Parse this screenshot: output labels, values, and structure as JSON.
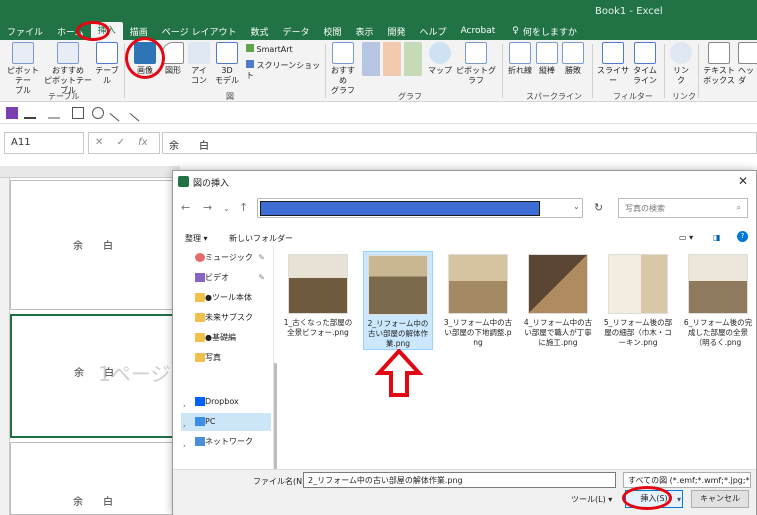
{
  "window": {
    "title": "Book1  -  Excel"
  },
  "tabs": [
    {
      "label": "ファイル"
    },
    {
      "label": "ホーム"
    },
    {
      "label": "挿入",
      "active": true
    },
    {
      "label": "描画"
    },
    {
      "label": "ページ レイアウト"
    },
    {
      "label": "数式"
    },
    {
      "label": "データ"
    },
    {
      "label": "校閲"
    },
    {
      "label": "表示"
    },
    {
      "label": "開発"
    },
    {
      "label": "ヘルプ"
    },
    {
      "label": "Acrobat"
    }
  ],
  "tell_me": "何をしますか",
  "ribbon": {
    "pivot_table": "ピボットテー\nブル",
    "recommended_pivot": "おすすめ\nピボットテーブル",
    "table": "テーブル",
    "pictures": "画像",
    "shapes": "図形",
    "icons": "アイ\nコン",
    "models_3d": "3D\nモデル",
    "smartart": "SmartArt",
    "screenshot": "スクリーンショット",
    "recommended_charts": "おすすめ\nグラフ",
    "maps": "マップ",
    "pivot_chart": "ピボットグラフ",
    "line": "折れ線",
    "column": "縦棒",
    "win_loss": "勝敗",
    "slicer": "スライサー",
    "timeline": "タイム\nライン",
    "link": "リン\nク",
    "textbox": "テキスト\nボックス",
    "header": "ヘッダ",
    "group_table": "テーブル",
    "group_illust": "図",
    "group_chart": "グラフ",
    "group_sparkline": "スパークライン",
    "group_filter": "フィルター",
    "group_link": "リンク"
  },
  "formula_bar": {
    "name_box": "A11",
    "fx": "fx",
    "content": "余　　白"
  },
  "sheet": {
    "margin_text": "余白",
    "watermark": "1ページ"
  },
  "dialog": {
    "title": "図の挿入",
    "search_placeholder": "写真の検索",
    "organize": "整理 ▾",
    "new_folder": "新しいフォルダー",
    "sidebar": [
      {
        "label": "ミュージック",
        "icon": "music-icon",
        "pinned": true
      },
      {
        "label": "ビデオ",
        "icon": "video-icon",
        "pinned": true
      },
      {
        "label": "●ツール本体",
        "icon": "folder-icon"
      },
      {
        "label": "未来サブスク",
        "icon": "folder-icon"
      },
      {
        "label": "●基礎編",
        "icon": "folder-icon"
      },
      {
        "label": "写真",
        "icon": "folder-icon"
      },
      {
        "label": "Dropbox",
        "icon": "dropbox-icon"
      },
      {
        "label": "PC",
        "icon": "pc-icon",
        "selected": true
      },
      {
        "label": "ネットワーク",
        "icon": "network-icon"
      }
    ],
    "files": [
      {
        "name": "1_古くなった部屋の全景ビフォー.png",
        "color": "#6f5a3e"
      },
      {
        "name": "2_リフォーム中の古い部屋の解体作業.png",
        "color": "#7b6a4b",
        "selected": true
      },
      {
        "name": "3_リフォーム中の古い部屋の下地調整.png",
        "color": "#a38a62"
      },
      {
        "name": "4_リフォーム中の古い部屋で職人が丁寧に施工.png",
        "color": "#5a4632"
      },
      {
        "name": "5_リフォーム後の部屋の細部（巾木・コーキン.png",
        "color": "#d9c7a8"
      },
      {
        "name": "6_リフォーム後の完成した部屋の全景（明るく.png",
        "color": "#8f7a5d"
      }
    ],
    "filename_label": "ファイル名(N):",
    "filename_value": "2_リフォーム中の古い部屋の解体作業.png",
    "filetype": "すべての図 (*.emf;*.wmf;*.jpg;*.jp",
    "tools": "ツール(L) ▾",
    "insert": "挿入(S)",
    "cancel": "キャンセル"
  },
  "colors": {
    "excel_green": "#217346",
    "annotation_red": "#e30613",
    "selection_blue": "#cce8ff"
  }
}
